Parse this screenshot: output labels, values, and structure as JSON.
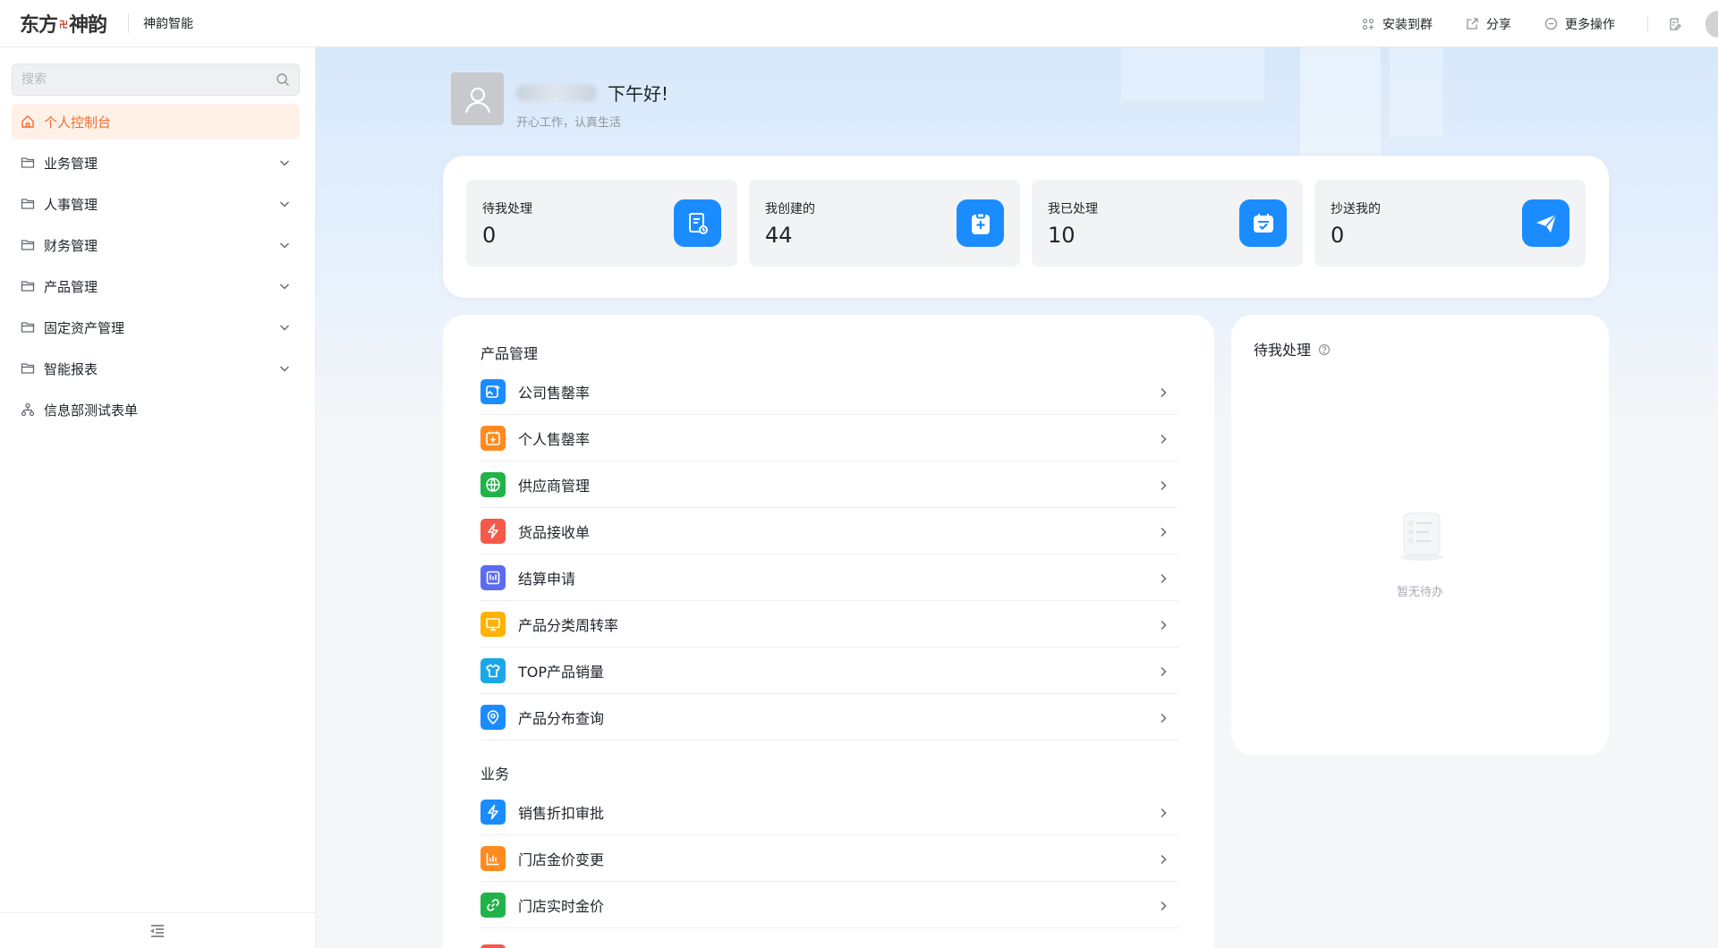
{
  "topbar": {
    "logo_text_left": "东方",
    "logo_text_mid": "卍",
    "logo_text_right": "神韵",
    "app_name": "神韵智能",
    "actions": [
      {
        "label": "安装到群",
        "icon": "apps-icon"
      },
      {
        "label": "分享",
        "icon": "share-icon"
      },
      {
        "label": "更多操作",
        "icon": "more-icon"
      }
    ]
  },
  "sidebar": {
    "search_placeholder": "搜索",
    "items": [
      {
        "label": "个人控制台",
        "icon": "home-icon",
        "active": true,
        "expandable": false
      },
      {
        "label": "业务管理",
        "icon": "folder-icon",
        "active": false,
        "expandable": true
      },
      {
        "label": "人事管理",
        "icon": "folder-icon",
        "active": false,
        "expandable": true
      },
      {
        "label": "财务管理",
        "icon": "folder-icon",
        "active": false,
        "expandable": true
      },
      {
        "label": "产品管理",
        "icon": "folder-icon",
        "active": false,
        "expandable": true
      },
      {
        "label": "固定资产管理",
        "icon": "folder-icon",
        "active": false,
        "expandable": true
      },
      {
        "label": "智能报表",
        "icon": "folder-icon",
        "active": false,
        "expandable": true
      },
      {
        "label": "信息部测试表单",
        "icon": "org-icon",
        "active": false,
        "expandable": false
      }
    ]
  },
  "greeting": {
    "hello": "下午好!",
    "subtitle": "开心工作，认真生活"
  },
  "stats": [
    {
      "label": "待我处理",
      "value": "0",
      "icon": "pending-doc-icon"
    },
    {
      "label": "我创建的",
      "value": "44",
      "icon": "create-clipboard-icon"
    },
    {
      "label": "我已处理",
      "value": "10",
      "icon": "handled-calendar-icon"
    },
    {
      "label": "抄送我的",
      "value": "0",
      "icon": "send-plane-icon"
    }
  ],
  "sections": [
    {
      "title": "产品管理",
      "items": [
        {
          "label": "公司售罄率",
          "color": "#1a8cff",
          "icon": "image-plus-icon"
        },
        {
          "label": "个人售罄率",
          "color": "#ff8a1f",
          "icon": "calendar-plus-icon"
        },
        {
          "label": "供应商管理",
          "color": "#21b34a",
          "icon": "globe-icon"
        },
        {
          "label": "货品接收单",
          "color": "#f5594a",
          "icon": "lightning-icon"
        },
        {
          "label": "结算申请",
          "color": "#5b6bf0",
          "icon": "book-icon"
        },
        {
          "label": "产品分类周转率",
          "color": "#ffb300",
          "icon": "monitor-icon"
        },
        {
          "label": "TOP产品销量",
          "color": "#1aa7e8",
          "icon": "tshirt-icon"
        },
        {
          "label": "产品分布查询",
          "color": "#1a8cff",
          "icon": "search-location-icon"
        }
      ]
    },
    {
      "title": "业务",
      "items": [
        {
          "label": "销售折扣审批",
          "color": "#1a8cff",
          "icon": "lightning-icon"
        },
        {
          "label": "门店金价变更",
          "color": "#ff8a1f",
          "icon": "bar-chart-icon"
        },
        {
          "label": "门店实时金价",
          "color": "#21b34a",
          "icon": "link-icon"
        }
      ]
    }
  ],
  "todo": {
    "title": "待我处理",
    "empty_text": "暂无待办"
  }
}
